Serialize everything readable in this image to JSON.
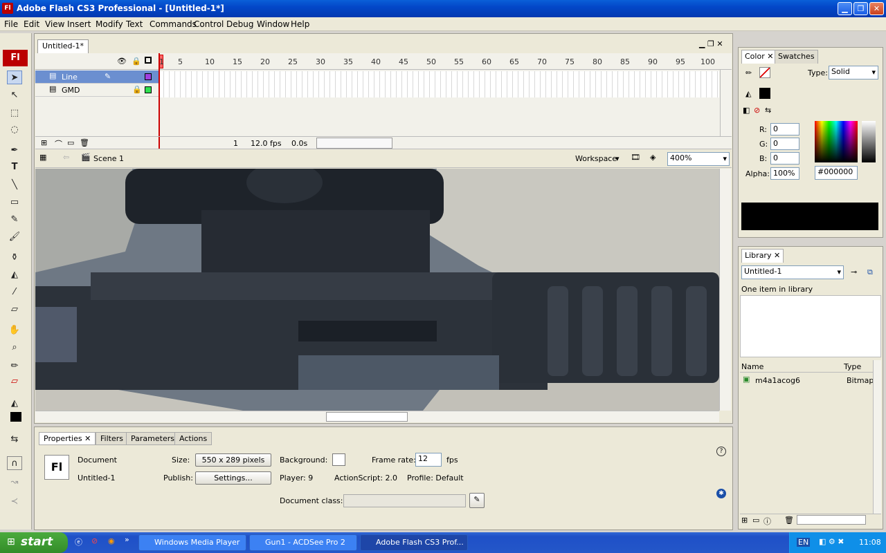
{
  "window": {
    "title": "Adobe Flash CS3 Professional - [Untitled-1*]",
    "app_icon": "Fl"
  },
  "menus": [
    "File",
    "Edit",
    "View",
    "Insert",
    "Modify",
    "Text",
    "Commands",
    "Control",
    "Debug",
    "Window",
    "Help"
  ],
  "document_tab": "Untitled-1*",
  "timeline": {
    "frame_numbers": [
      "1",
      "5",
      "10",
      "15",
      "20",
      "25",
      "30",
      "35",
      "40",
      "45",
      "50",
      "55",
      "60",
      "65",
      "70",
      "75",
      "80",
      "85",
      "90",
      "95",
      "100"
    ],
    "layers": [
      {
        "name": "Line",
        "color": "#a040e0"
      },
      {
        "name": "GMD",
        "color": "#30e050"
      }
    ],
    "current_frame": "1",
    "fps": "12.0 fps",
    "time": "0.0s"
  },
  "stagebar": {
    "scene": "Scene 1",
    "workspace": "Workspace",
    "zoom": "400%"
  },
  "properties": {
    "tabs": [
      "Properties",
      "Filters",
      "Parameters",
      "Actions"
    ],
    "type_label": "Document",
    "doc_name": "Untitled-1",
    "size_label": "Size:",
    "size_value": "550 x 289 pixels",
    "publish_label": "Publish:",
    "settings_button": "Settings...",
    "background_label": "Background:",
    "framerate_label": "Frame rate:",
    "framerate_value": "12",
    "fps_unit": "fps",
    "player": "Player:  9",
    "actionscript": "ActionScript:  2.0",
    "profile": "Profile:  Default",
    "docclass_label": "Document class:"
  },
  "color_panel": {
    "tabs": [
      "Color",
      "Swatches"
    ],
    "type_label": "Type:",
    "type_value": "Solid",
    "r_label": "R:",
    "r": "0",
    "g_label": "G:",
    "g": "0",
    "b_label": "B:",
    "b": "0",
    "alpha_label": "Alpha:",
    "alpha": "100%",
    "hex": "#000000"
  },
  "library": {
    "tab": "Library",
    "doc": "Untitled-1",
    "count": "One item in library",
    "col_name": "Name",
    "col_type": "Type",
    "items": [
      {
        "name": "m4a1acog6",
        "type": "Bitmap"
      }
    ]
  },
  "taskbar": {
    "start": "start",
    "tasks": [
      "Windows Media Player",
      "Gun1 - ACDSee Pro 2",
      "Adobe Flash CS3 Prof..."
    ],
    "lang": "EN",
    "clock": "11:08"
  }
}
